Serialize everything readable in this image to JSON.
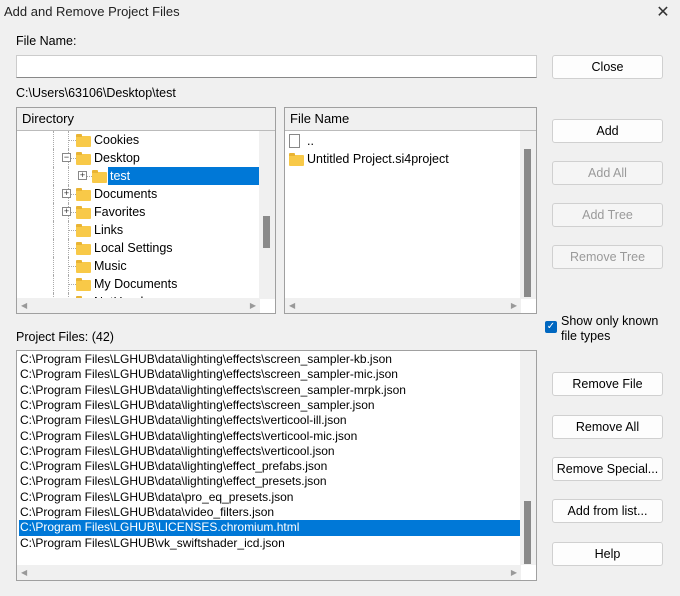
{
  "window": {
    "title": "Add and Remove Project Files",
    "close_icon": "close-icon"
  },
  "file_name": {
    "label": "File Name:",
    "value": ""
  },
  "current_path": "C:\\Users\\63106\\Desktop\\test",
  "directory": {
    "header": "Directory",
    "items": [
      {
        "label": "Cookies",
        "level": 1,
        "expander": "none"
      },
      {
        "label": "Desktop",
        "level": 1,
        "expander": "minus"
      },
      {
        "label": "test",
        "level": 2,
        "expander": "plus",
        "selected": true
      },
      {
        "label": "Documents",
        "level": 1,
        "expander": "plus"
      },
      {
        "label": "Favorites",
        "level": 1,
        "expander": "plus"
      },
      {
        "label": "Links",
        "level": 1,
        "expander": "none"
      },
      {
        "label": "Local Settings",
        "level": 1,
        "expander": "none"
      },
      {
        "label": "Music",
        "level": 1,
        "expander": "none"
      },
      {
        "label": "My Documents",
        "level": 1,
        "expander": "none"
      },
      {
        "label": "NetHood",
        "level": 1,
        "expander": "none"
      }
    ]
  },
  "files": {
    "header": "File Name",
    "items": [
      {
        "label": "..",
        "icon": "file-icon"
      },
      {
        "label": "Untitled Project.si4project",
        "icon": "folder-icon"
      }
    ]
  },
  "buttons": {
    "close": "Close",
    "add": "Add",
    "add_all": "Add All",
    "add_tree": "Add Tree",
    "remove_tree": "Remove Tree",
    "remove_file": "Remove File",
    "remove_all": "Remove All",
    "remove_special": "Remove Special...",
    "add_from_list": "Add from list...",
    "help": "Help"
  },
  "disabled": [
    "add_all",
    "add_tree",
    "remove_tree"
  ],
  "show_known": {
    "label": "Show only known file types",
    "checked": true
  },
  "project_files": {
    "label": "Project Files: (42)",
    "selected_index": 11,
    "items": [
      "C:\\Program Files\\LGHUB\\data\\lighting\\effects\\screen_sampler-kb.json",
      "C:\\Program Files\\LGHUB\\data\\lighting\\effects\\screen_sampler-mic.json",
      "C:\\Program Files\\LGHUB\\data\\lighting\\effects\\screen_sampler-mrpk.json",
      "C:\\Program Files\\LGHUB\\data\\lighting\\effects\\screen_sampler.json",
      "C:\\Program Files\\LGHUB\\data\\lighting\\effects\\verticool-ill.json",
      "C:\\Program Files\\LGHUB\\data\\lighting\\effects\\verticool-mic.json",
      "C:\\Program Files\\LGHUB\\data\\lighting\\effects\\verticool.json",
      "C:\\Program Files\\LGHUB\\data\\lighting\\effect_prefabs.json",
      "C:\\Program Files\\LGHUB\\data\\lighting\\effect_presets.json",
      "C:\\Program Files\\LGHUB\\data\\pro_eq_presets.json",
      "C:\\Program Files\\LGHUB\\data\\video_filters.json",
      "C:\\Program Files\\LGHUB\\LICENSES.chromium.html",
      "C:\\Program Files\\LGHUB\\vk_swiftshader_icd.json"
    ]
  },
  "colors": {
    "selection": "#0078d7",
    "checkbox": "#0067c0"
  }
}
